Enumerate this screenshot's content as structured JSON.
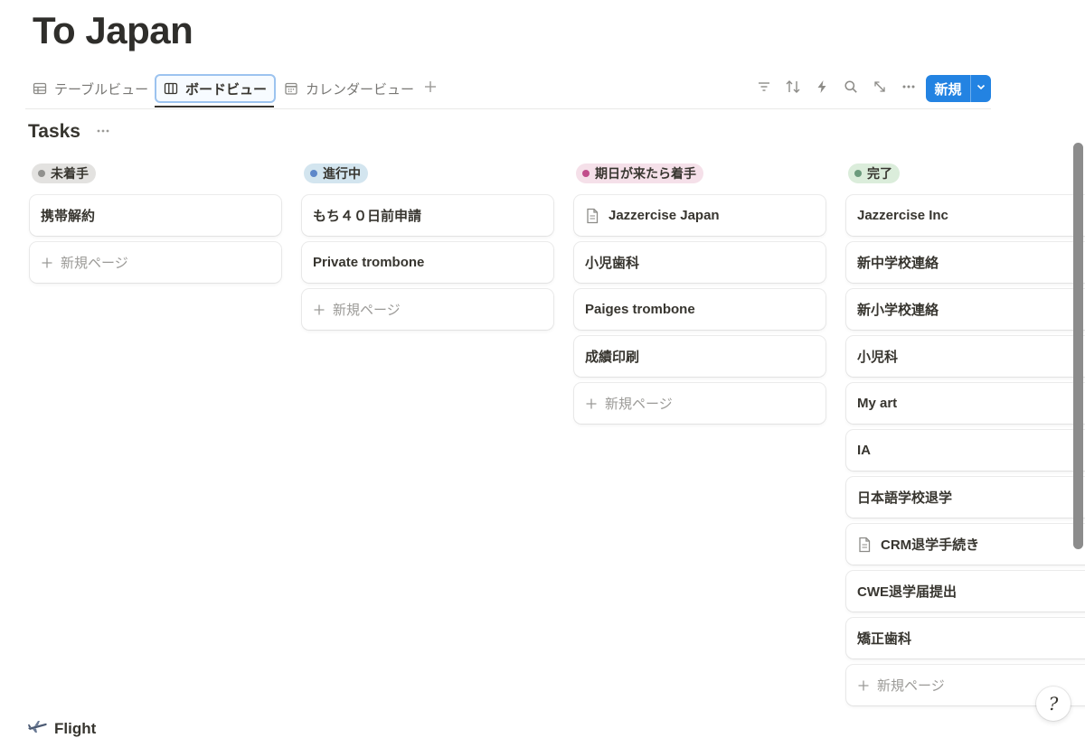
{
  "page": {
    "title": "To Japan"
  },
  "views": {
    "tabs": [
      {
        "label": "テーブルビュー",
        "icon": "table-icon"
      },
      {
        "label": "ボードビュー",
        "icon": "board-icon",
        "active": true
      },
      {
        "label": "カレンダービュー",
        "icon": "calendar-icon"
      }
    ],
    "add_icon": "plus-icon",
    "toolbar": [
      "filter-icon",
      "sort-icon",
      "automation-icon",
      "search-icon",
      "expand-icon",
      "more-icon"
    ],
    "new_button": {
      "label": "新規",
      "dropdown_icon": "chevron-down-icon"
    }
  },
  "database": {
    "title": "Tasks"
  },
  "board": {
    "add_label": "新規ページ",
    "groups": [
      {
        "label": "未着手",
        "dot_color": "#91918e",
        "bg_color": "#e3e2e0",
        "cards": [
          {
            "title": "携帯解約"
          }
        ]
      },
      {
        "label": "進行中",
        "dot_color": "#5e87c9",
        "bg_color": "#d3e5ef",
        "cards": [
          {
            "title": "もち４０日前申請"
          },
          {
            "title": "Private trombone"
          }
        ]
      },
      {
        "label": "期日が来たら着手",
        "dot_color": "#c14c8a",
        "bg_color": "#f5e0e9",
        "cards": [
          {
            "title": "Jazzercise Japan",
            "has_icon": true
          },
          {
            "title": "小児歯科"
          },
          {
            "title": "Paiges trombone"
          },
          {
            "title": "成績印刷"
          }
        ]
      },
      {
        "label": "完了",
        "dot_color": "#6c9b7d",
        "bg_color": "#dbeddb",
        "cards": [
          {
            "title": "Jazzercise Inc"
          },
          {
            "title": "新中学校連絡"
          },
          {
            "title": "新小学校連絡"
          },
          {
            "title": "小児科"
          },
          {
            "title": "My art"
          },
          {
            "title": "IA"
          },
          {
            "title": "日本語学校退学"
          },
          {
            "title": "CRM退学手続き",
            "has_icon": true
          },
          {
            "title": "CWE退学届提出"
          },
          {
            "title": "矯正歯科"
          }
        ]
      }
    ]
  },
  "next_section": {
    "icon": "airplane-icon",
    "title": "Flight"
  },
  "help": {
    "glyph": "?"
  }
}
